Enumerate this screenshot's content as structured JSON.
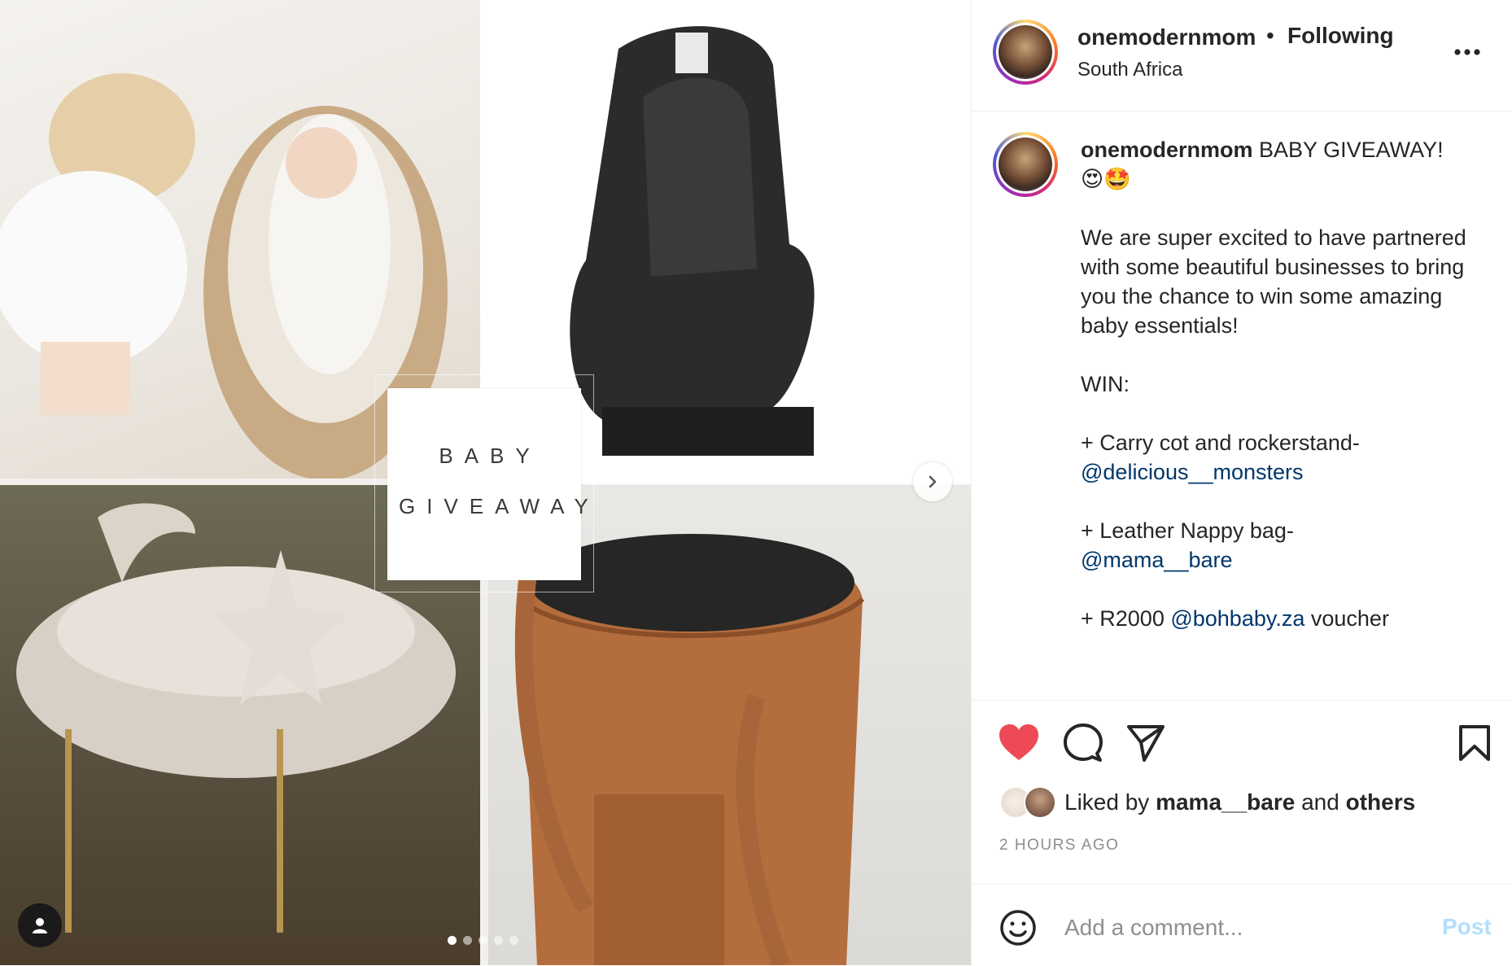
{
  "carousel": {
    "overlay_line1": "BABY",
    "overlay_line2": "GIVEAWAY",
    "dot_count": 5,
    "active_dot": 1
  },
  "header": {
    "username": "onemodernmom",
    "separator": "•",
    "follow_label": "Following",
    "location": "South Africa"
  },
  "caption": {
    "username": "onemodernmom",
    "first_line": " BABY GIVEAWAY!",
    "emojis": "😍🤩",
    "body": "We are super excited to have partnered with some beautiful businesses to bring you the chance to win some amazing baby essentials!",
    "win_label": "WIN:",
    "item1_text": "+ Carry cot and rockerstand-",
    "item1_mention": "@delicious__monsters",
    "item2_text": "+ Leather Nappy bag-",
    "item2_mention": "@mama__bare",
    "item3_prefix": "+ R2000 ",
    "item3_mention": "@bohbaby.za",
    "item3_suffix": " voucher"
  },
  "likes": {
    "prefix": "Liked by ",
    "user": "mama__bare",
    "middle": " and ",
    "others": "others"
  },
  "timestamp": "2 HOURS AGO",
  "comment": {
    "placeholder": "Add a comment...",
    "post_label": "Post"
  },
  "colors": {
    "like_red": "#ed4956",
    "mention_blue": "#00376b",
    "post_disabled": "#b2dffc"
  },
  "icons": [
    "heart-icon",
    "comment-icon",
    "share-icon",
    "bookmark-icon",
    "more-icon",
    "emoji-icon",
    "user-tag-icon",
    "chevron-right-icon"
  ]
}
